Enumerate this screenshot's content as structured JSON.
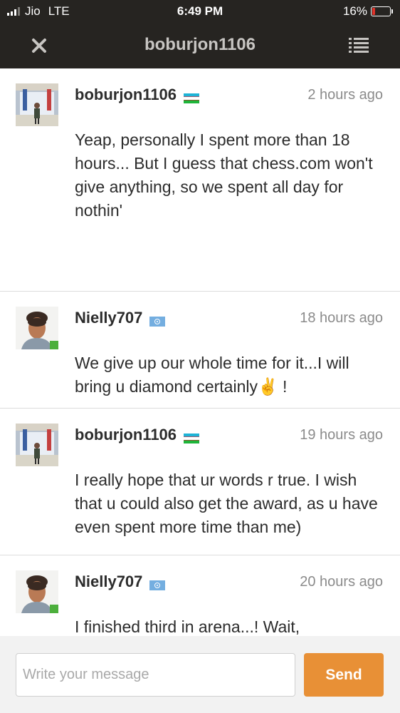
{
  "status_bar": {
    "carrier": "Jio",
    "network": "LTE",
    "time": "6:49 PM",
    "battery": "16%",
    "battery_color": "#e0332a"
  },
  "header": {
    "title": "boburjon1106",
    "close_icon": "close-icon",
    "menu_icon": "list-menu-icon"
  },
  "messages": [
    {
      "username": "boburjon1106",
      "flag": "uzbekistan-flag",
      "time": "2 hours ago",
      "text": "Yeap, personally I spent more than 18 hours... But I guess that chess.com won't give anything, so we spent all day for nothin'"
    },
    {
      "username": "Nielly707",
      "flag": "united-nations-flag",
      "time": "18 hours ago",
      "text": "We give up our whole time for it...I will bring u diamond certainly✌️ !"
    },
    {
      "username": "boburjon1106",
      "flag": "uzbekistan-flag",
      "time": "19 hours ago",
      "text": "I really hope that ur words r true.  I wish that u could also get the award, as u have even spent more time than me)"
    },
    {
      "username": "Nielly707",
      "flag": "united-nations-flag",
      "time": "20 hours ago",
      "text": "I finished third in arena...! Wait,"
    }
  ],
  "composer": {
    "placeholder": "Write your message",
    "send_label": "Send"
  },
  "colors": {
    "header_bg": "#262421",
    "send_button": "#e89036"
  }
}
